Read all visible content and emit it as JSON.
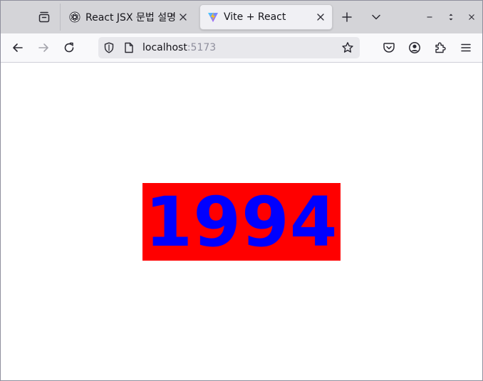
{
  "browser": {
    "tabs": [
      {
        "title": "React JSX 문법 설명",
        "favicon": "openai-icon",
        "active": false
      },
      {
        "title": "Vite + React",
        "favicon": "vite-icon",
        "active": true
      }
    ],
    "url": {
      "host": "localhost",
      "port": ":5173"
    },
    "colors": {
      "tabstrip": "#d4d4d8",
      "toolbar": "#f9f9fb",
      "urlbar": "#e8e8ec"
    }
  },
  "page": {
    "year": "1994",
    "colors": {
      "box_background": "#ff0000",
      "text": "#0000ff"
    }
  }
}
